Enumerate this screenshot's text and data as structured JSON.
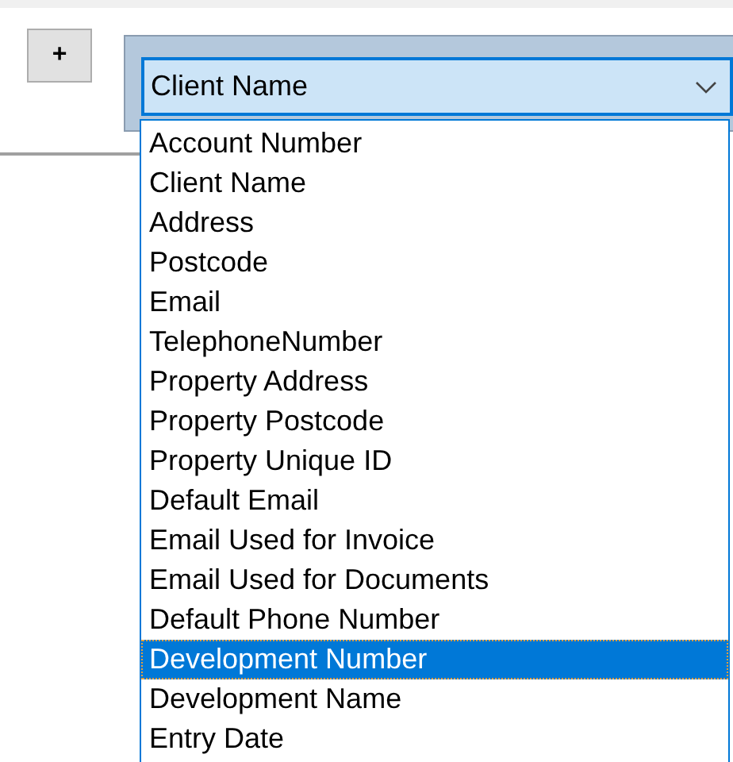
{
  "add_button": {
    "label": "+"
  },
  "combo": {
    "value": "Client Name",
    "expanded": true
  },
  "options": [
    {
      "label": "Account Number",
      "selected": false
    },
    {
      "label": "Client Name",
      "selected": false
    },
    {
      "label": "Address",
      "selected": false
    },
    {
      "label": "Postcode",
      "selected": false
    },
    {
      "label": "Email",
      "selected": false
    },
    {
      "label": "TelephoneNumber",
      "selected": false
    },
    {
      "label": "Property Address",
      "selected": false
    },
    {
      "label": "Property Postcode",
      "selected": false
    },
    {
      "label": "Property Unique ID",
      "selected": false
    },
    {
      "label": "Default Email",
      "selected": false
    },
    {
      "label": "Email Used for Invoice",
      "selected": false
    },
    {
      "label": "Email Used for Documents",
      "selected": false
    },
    {
      "label": "Default Phone Number",
      "selected": false
    },
    {
      "label": "Development Number",
      "selected": true
    },
    {
      "label": "Development Name",
      "selected": false
    },
    {
      "label": "Entry Date",
      "selected": false
    }
  ]
}
